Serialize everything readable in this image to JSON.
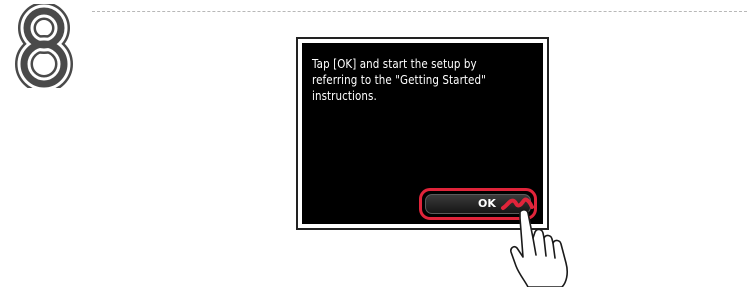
{
  "step": {
    "number": "8"
  },
  "screen": {
    "message": "Tap [OK] and start the setup by referring to the \"Getting Started\" instructions.",
    "ok_button_label": "OK"
  },
  "icons": {
    "step_number_glyph": "outlined-number-8",
    "tap_indicator": "tap-gesture-icon",
    "hand": "pointing-hand-icon"
  },
  "colors": {
    "highlight": "#e0243a",
    "screen_background": "#000000",
    "screen_text": "#ffffff"
  }
}
